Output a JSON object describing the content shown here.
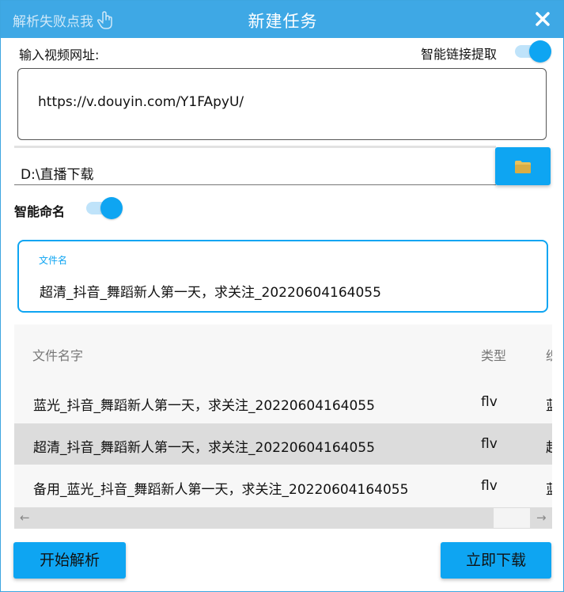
{
  "titlebar": {
    "fail_link": "解析失败点我",
    "title": "新建任务",
    "close_icon": "close-icon",
    "bg_color": "#3ea8e5"
  },
  "url_section": {
    "label": "输入视频网址:",
    "smart_link_label": "智能链接提取",
    "smart_link_on": true,
    "url_value": "https://v.douyin.com/Y1FApyU/"
  },
  "path_section": {
    "path_value": "D:\\直播下载",
    "folder_icon": "folder-icon"
  },
  "naming": {
    "smart_name_label": "智能命名",
    "smart_name_on": true,
    "filename_caption": "文件名",
    "filename_value": "超清_抖音_舞蹈新人第一天，求关注_20220604164055"
  },
  "table": {
    "headers": [
      "文件名字",
      "类型",
      "织"
    ],
    "rows": [
      {
        "name": "蓝光_抖音_舞蹈新人第一天，求关注_20220604164055",
        "type": "flv",
        "extra": "蓝",
        "selected": false
      },
      {
        "name": "超清_抖音_舞蹈新人第一天，求关注_20220604164055",
        "type": "flv",
        "extra": "超",
        "selected": true
      },
      {
        "name": "备用_蓝光_抖音_舞蹈新人第一天，求关注_20220604164055",
        "type": "flv",
        "extra": "蓝",
        "selected": false
      }
    ]
  },
  "buttons": {
    "parse": "开始解析",
    "download": "立即下载"
  },
  "colors": {
    "accent": "#0ea5f2",
    "selected_row": "#dcdcdc"
  }
}
